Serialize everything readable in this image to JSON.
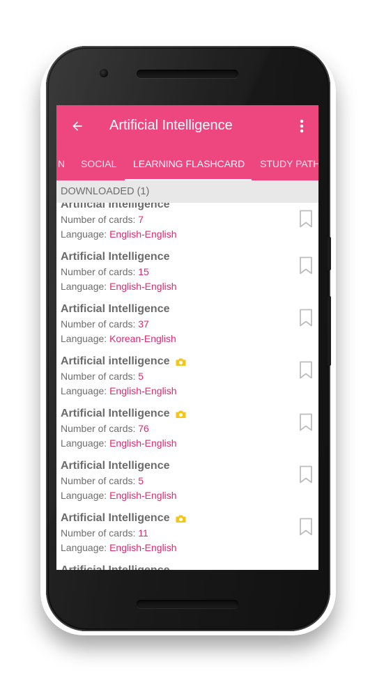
{
  "app": {
    "title": "Artificial Intelligence",
    "back_icon": "arrow-back-icon",
    "menu_icon": "more-vert-icon"
  },
  "tabs": [
    {
      "label": "N"
    },
    {
      "label": "SOCIAL"
    },
    {
      "label": "LEARNING FLASHCARD",
      "active": true
    },
    {
      "label": "STUDY PATH"
    }
  ],
  "section": {
    "header": "DOWNLOADED (1)"
  },
  "labels": {
    "cards": "Number of cards: ",
    "language": "Language: "
  },
  "items": [
    {
      "title": "Artificial Intelligence",
      "cards": "7",
      "language": "English-English",
      "photo": false
    },
    {
      "title": "Artificial Intelligence",
      "cards": "15",
      "language": "English-English",
      "photo": false
    },
    {
      "title": "Artificial Intelligence",
      "cards": "37",
      "language": "Korean-English",
      "photo": false
    },
    {
      "title": "Artificial intelligence",
      "cards": "5",
      "language": "English-English",
      "photo": true
    },
    {
      "title": "Artificial Intelligence",
      "cards": "76",
      "language": "English-English",
      "photo": true
    },
    {
      "title": "Artificial Intelligence",
      "cards": "5",
      "language": "English-English",
      "photo": false
    },
    {
      "title": "Artificial Intelligence",
      "cards": "11",
      "language": "English-English",
      "photo": true
    },
    {
      "title": "Artificial Intelligence"
    }
  ],
  "colors": {
    "primary": "#ee467e",
    "accent": "#e6266f",
    "photo_badge": "#f5c518",
    "bookmark": "#bdbdbd"
  }
}
